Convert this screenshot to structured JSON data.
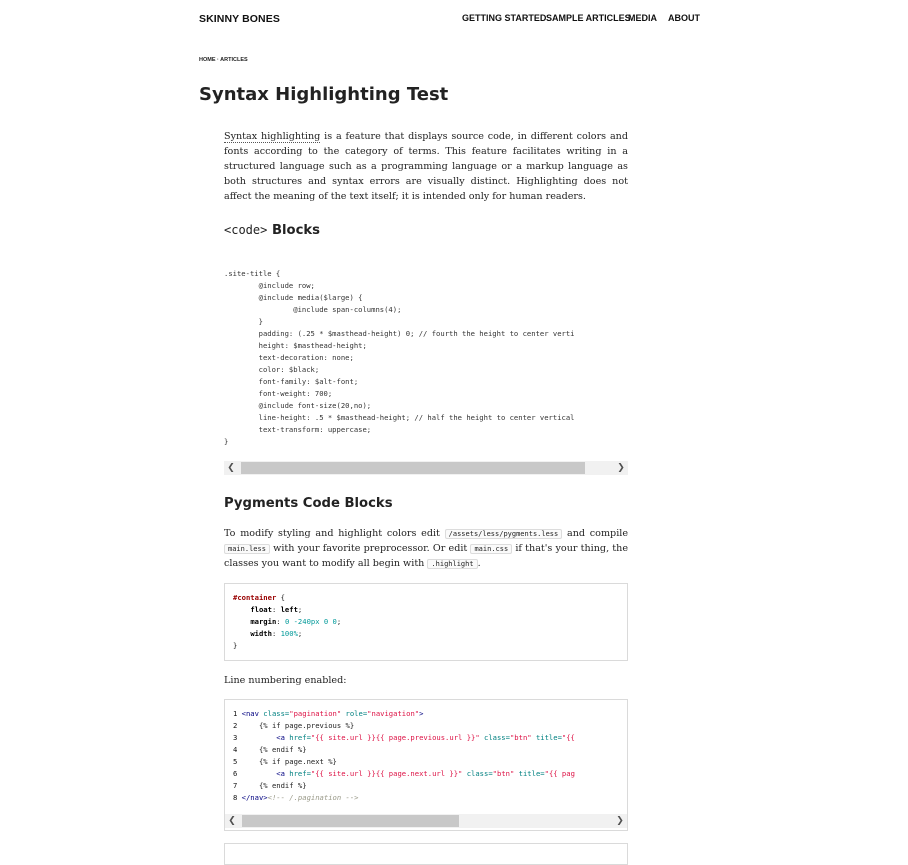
{
  "site": {
    "title": "SKINNY BONES"
  },
  "nav": {
    "items": [
      "GETTING STARTED",
      "SAMPLE ARTICLES",
      "MEDIA",
      "ABOUT"
    ]
  },
  "breadcrumb": {
    "text": "HOME · ARTICLES"
  },
  "page": {
    "title": "Syntax Highlighting Test"
  },
  "intro": {
    "link_text": "Syntax highlighting",
    "text": " is a feature that displays source code, in different colors and fonts according to the category of terms. This feature facilitates writing in a structured language such as a programming language or a markup language as both structures and syntax errors are visually distinct. Highlighting does not affect the meaning of the text itself; it is intended only for human readers."
  },
  "section1": {
    "heading_code": "<code>",
    "heading_text": " Blocks"
  },
  "code_block": {
    "lines": [
      ".site-title {",
      "        @include row;",
      "        @include media($large) {",
      "                @include span-columns(4);",
      "        }",
      "        padding: (.25 * $masthead-height) 0; // fourth the height to center verti",
      "        height: $masthead-height;",
      "        text-decoration: none;",
      "        color: $black;",
      "        font-family: $alt-font;",
      "        font-weight: 700;",
      "        @include font-size(20,no);",
      "        line-height: .5 * $masthead-height; // half the height to center vertical",
      "        text-transform: uppercase;",
      "}"
    ]
  },
  "scroll": {
    "left_arrow": "❮",
    "right_arrow": "❯"
  },
  "section2": {
    "heading": "Pygments Code Blocks"
  },
  "pygments_para": {
    "t1": "To modify styling and highlight colors edit ",
    "c1": "/assets/less/pygments.less",
    "t2": " and compile ",
    "c2": "main.less",
    "t3": " with your favorite preprocessor. Or edit ",
    "c3": "main.css",
    "t4": " if that's your thing, the classes you want to modify all begin with ",
    "c4": ".highlight",
    "t5": "."
  },
  "css_block": {
    "selector": "#container",
    "props": [
      {
        "name": "float",
        "value": "left"
      },
      {
        "name": "margin",
        "value": "0 -240px 0 0"
      },
      {
        "name": "width",
        "value": "100%"
      }
    ]
  },
  "line_numbering": {
    "label": "Line numbering enabled:"
  },
  "numbered_block": {
    "nav_class": "pagination",
    "nav_role": "navigation",
    "if_prev": "{% if page.previous %}",
    "href_prev": "{{ site.url }}{{ page.previous.url }}",
    "href_next": "{{ site.url }}{{ page.next.url }}",
    "btn_class": "btn",
    "title_cut1": "{{",
    "title_cut2": "{{ pag",
    "endif": "{% endif %}",
    "if_next": "{% if page.next %}",
    "comment": "<!-- /.pagination -->"
  },
  "colors": {
    "text": "#222222",
    "selector": "#990000",
    "number": "#009999",
    "attr": "#008080",
    "string": "#dd1144",
    "tag": "#000080"
  }
}
